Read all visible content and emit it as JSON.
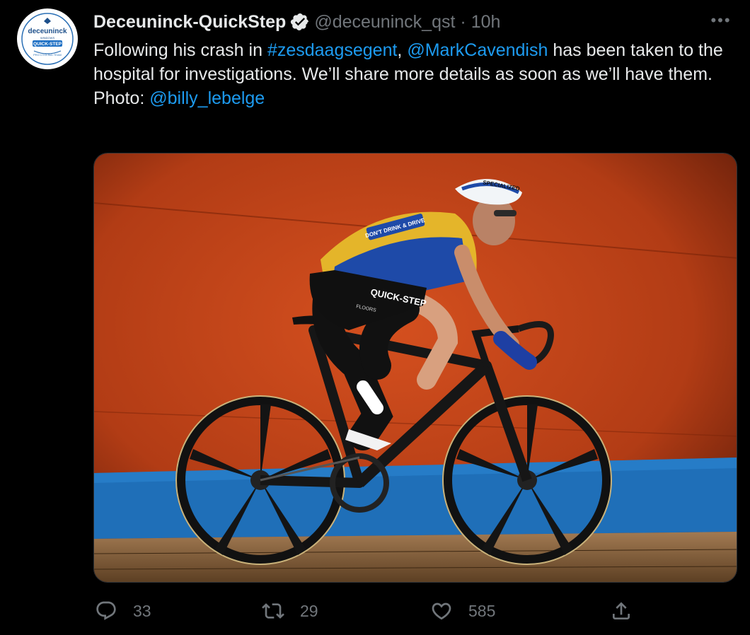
{
  "tweet": {
    "display_name": "Deceuninck-QuickStep",
    "handle": "@deceuninck_qst",
    "separator": "·",
    "time": "10h",
    "more_label": "•••",
    "text": {
      "part1": "Following his crash in ",
      "hashtag": "#zesdaagsegent",
      "part2": ", ",
      "mention": "@MarkCavendish",
      "part3": " has been taken to the hospital for investigations. We’ll share more details as soon as we’ll have them.",
      "photo_label": "Photo: ",
      "photo_credit": "@billy_lebelge"
    },
    "avatar_logo": {
      "brand": "deceuninck",
      "small": "WINDOWS",
      "team": "QUICK-STEP",
      "ring": "PRO CYCLING TEAM"
    },
    "media": {
      "jersey_text": "DON'T DRINK & DRIVE",
      "shorts_brand": "QUICK-STEP",
      "shorts_sub": "FLOORS",
      "helmet_brand": "SPECIALIZED"
    },
    "stats": {
      "replies": "33",
      "retweets": "29",
      "likes": "585"
    },
    "icons": {
      "verified": "verified-badge-icon",
      "reply": "reply-icon",
      "retweet": "retweet-icon",
      "like": "heart-icon",
      "share": "share-icon"
    },
    "colors": {
      "link": "#1d9bf0",
      "muted": "#71767b",
      "text": "#e7e9ea",
      "background": "#000000"
    }
  }
}
